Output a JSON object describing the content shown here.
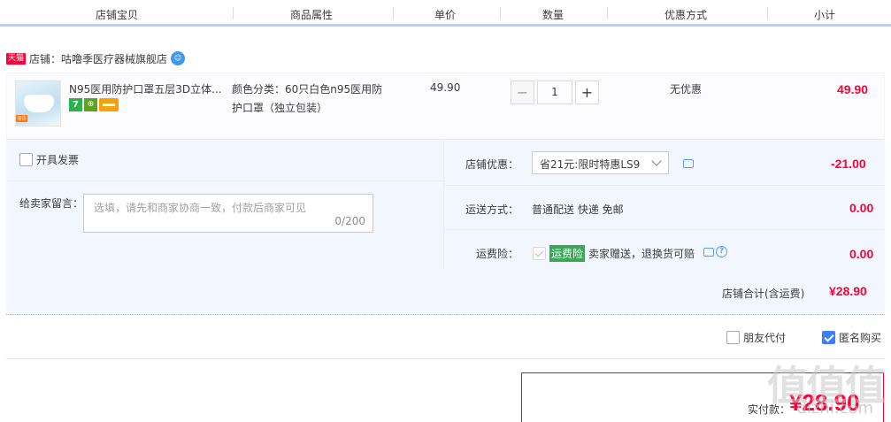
{
  "header": {
    "col_item": "店铺宝贝",
    "col_attr": "商品属性",
    "col_price": "单价",
    "col_qty": "数量",
    "col_discount": "优惠方式",
    "col_subtotal": "小计"
  },
  "shop": {
    "badge": "天猫",
    "label": "店铺：咕噜季医疗器械旗舰店"
  },
  "item": {
    "title": "N95医用防护口罩五层3D立体...",
    "thumb_tag": "60",
    "attr_line1": "颜色分类：60只白色n95医用防",
    "attr_line2": "护口罩（独立包装）",
    "price": "49.90",
    "qty_minus": "−",
    "qty_value": "1",
    "qty_plus": "+",
    "discount": "无优惠",
    "subtotal": "49.90"
  },
  "options": {
    "invoice_label": "开具发票",
    "message_label": "给卖家留言：",
    "message_placeholder": "选填，请先和商家协商一致，付款后商家可见",
    "message_count": "0/200",
    "shop_discount_label": "店铺优惠：",
    "shop_discount_value": "省21元:限时特惠LS9",
    "shop_discount_amount": "-21.00",
    "shipping_label": "运送方式：",
    "shipping_value": "普通配送 快递 免邮",
    "shipping_amount": "0.00",
    "insurance_label": "运费险：",
    "insurance_badge": "运费险",
    "insurance_text": "卖家赠送，退换货可赔",
    "insurance_amount": "0.00"
  },
  "total": {
    "label": "店铺合计(含运费)",
    "amount": "¥28.90"
  },
  "extras": {
    "friend_pay_label": "朋友代付",
    "anonymous_label": "匿名购买"
  },
  "payment": {
    "label": "实付款：",
    "amount": "¥28.90"
  },
  "watermark": {
    "big": "值值值",
    "small": "dizhi.com"
  },
  "colors": {
    "accent_red": "#ff0036",
    "accent_blue": "#3d7eff",
    "panel_bg": "#f2f7ff"
  }
}
